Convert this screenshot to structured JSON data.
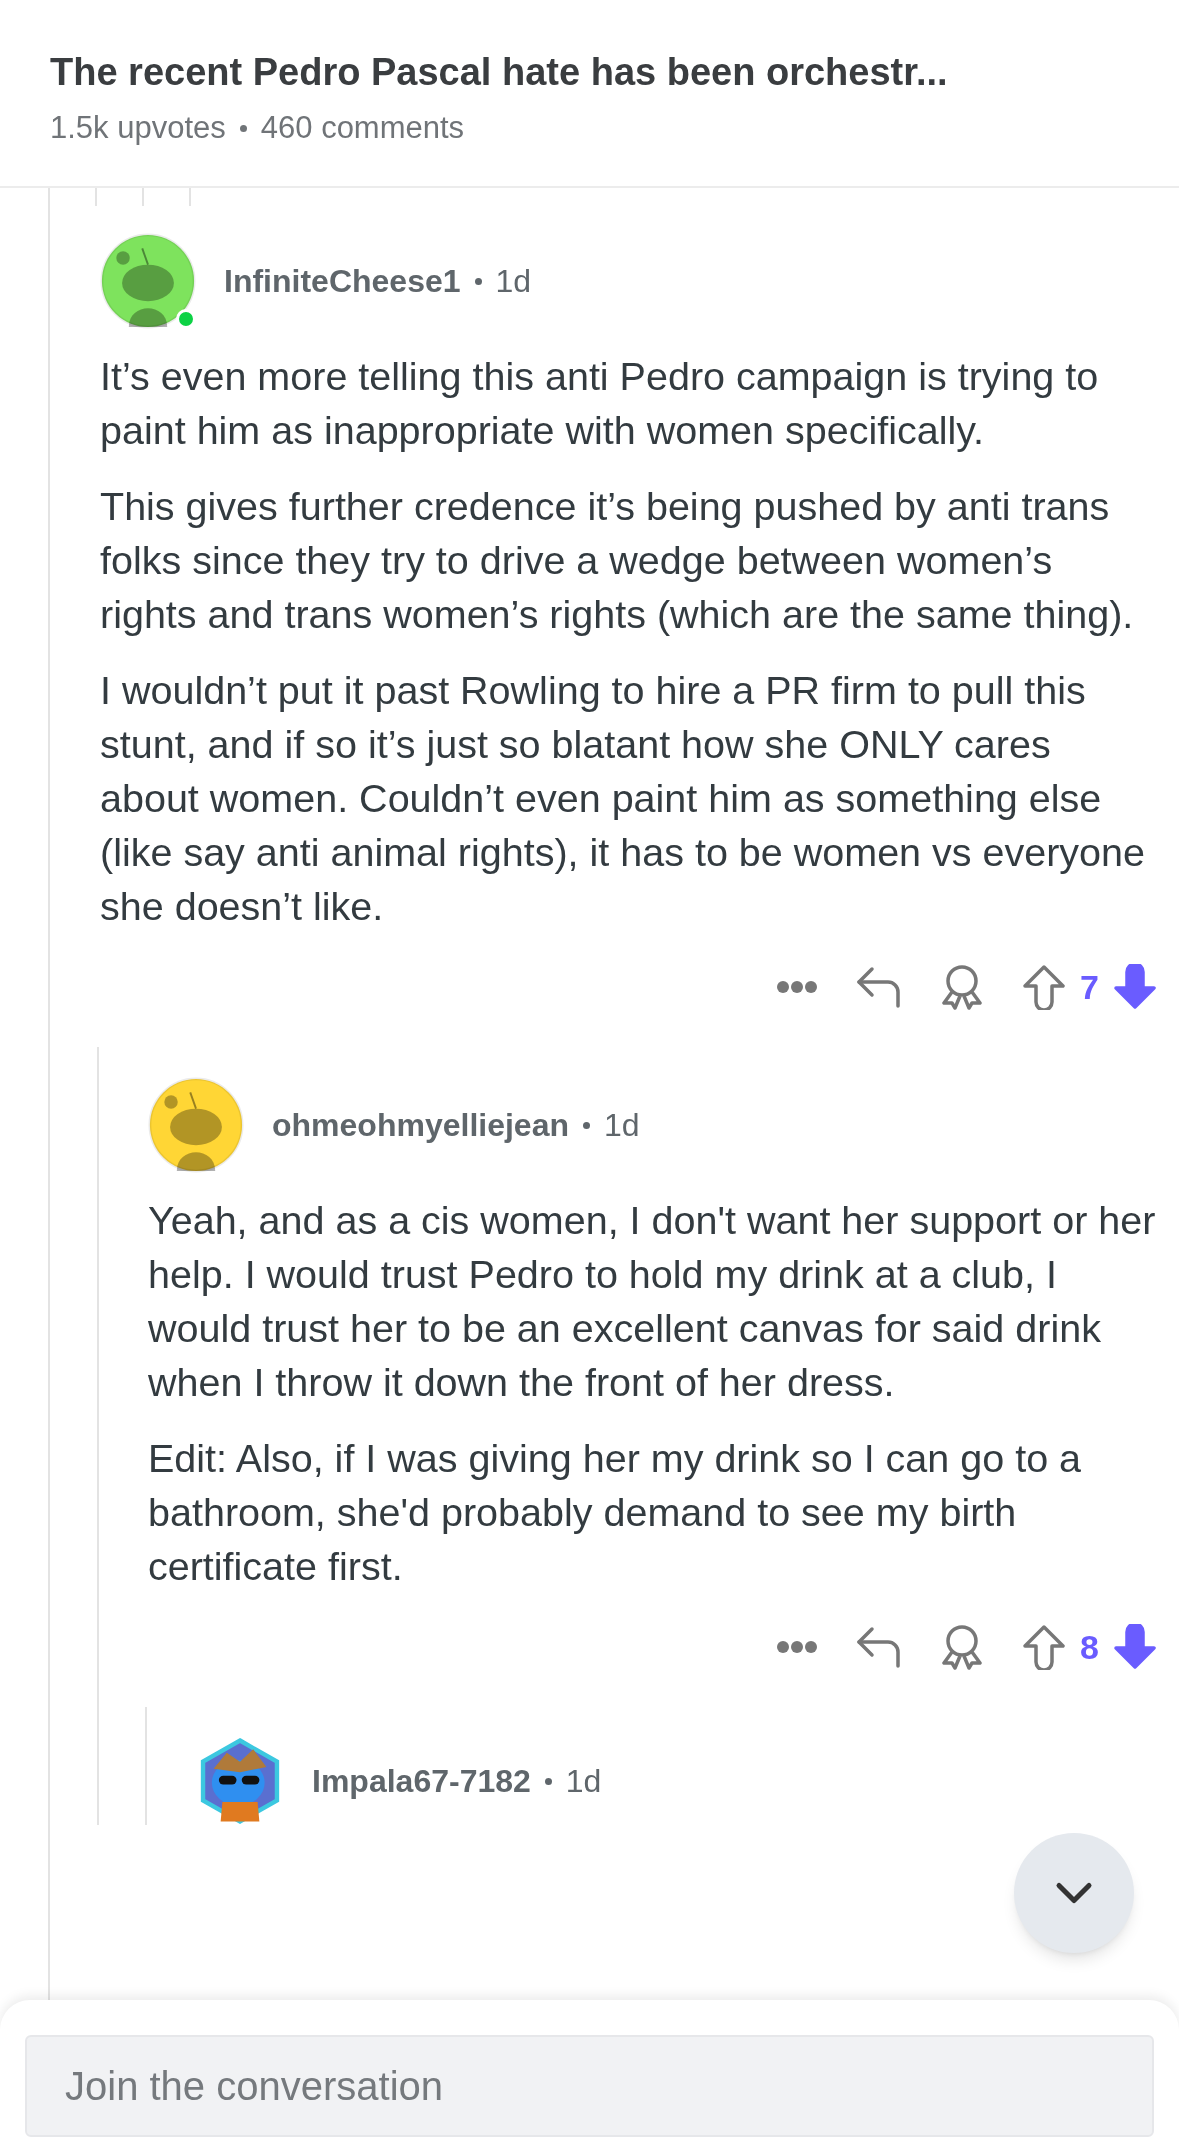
{
  "post": {
    "title": "The recent Pedro Pascal hate has been orchestr...",
    "upvotes": "1.5k upvotes",
    "comments": "460 comments"
  },
  "comments": [
    {
      "username": "InfiniteCheese1",
      "age": "1d",
      "avatar": {
        "kind": "snoo",
        "color": "#7ee35d",
        "online": true
      },
      "paragraphs": [
        "It’s even more telling this anti Pedro campaign is trying to paint him as inappropriate with women specifically.",
        "This gives further credence it’s being pushed by anti trans folks since they try to drive a wedge between women’s rights and trans women’s rights (which are the same thing).",
        "I wouldn’t put it past Rowling to hire a PR firm to pull this stunt, and if so it’s just so blatant how she ONLY cares about women. Couldn’t even paint him as something else (like say anti animal rights), it has to be women vs everyone she doesn’t like."
      ],
      "score": "7",
      "downvoted": true,
      "children": [
        {
          "username": "ohmeohmyelliejean",
          "age": "1d",
          "avatar": {
            "kind": "snoo",
            "color": "#ffd635",
            "online": false
          },
          "paragraphs": [
            "Yeah, and as a cis women, I don't want her support or her help. I would trust Pedro to hold my drink at a club, I would trust her to be an excellent canvas for said drink when I throw it down the front of her dress.",
            "Edit: Also, if I was giving her my drink so I can go to a bathroom, she'd probably demand to see my birth certificate first."
          ],
          "score": "8",
          "downvoted": true,
          "children": [
            {
              "username": "Impala67-7182",
              "age": "1d",
              "avatar": {
                "kind": "custom",
                "color": "#2f8ff0",
                "online": false
              }
            }
          ]
        }
      ]
    }
  ],
  "composer": {
    "placeholder": "Join the conversation"
  }
}
